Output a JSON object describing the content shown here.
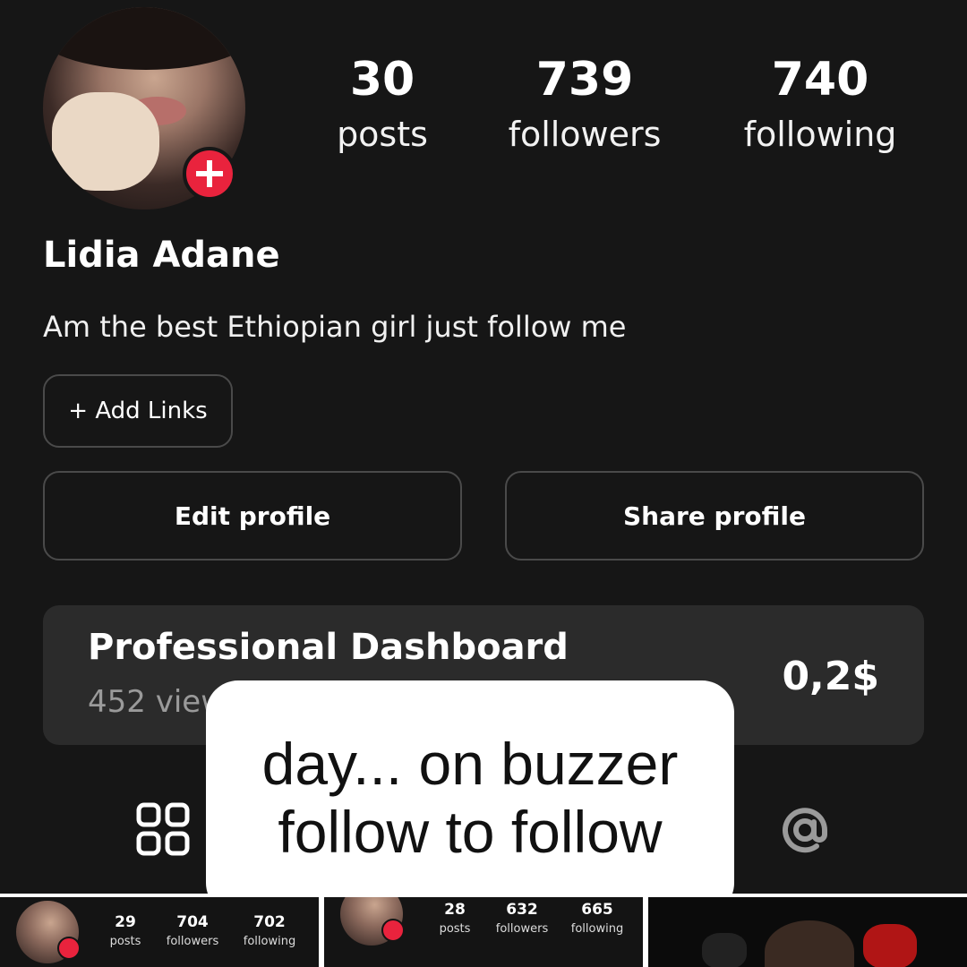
{
  "profile": {
    "name": "Lidia Adane",
    "bio": "Am the best Ethiopian girl just follow me",
    "stats": {
      "posts": {
        "value": "30",
        "label": "posts"
      },
      "followers": {
        "value": "739",
        "label": "followers"
      },
      "following": {
        "value": "740",
        "label": "following"
      }
    }
  },
  "buttons": {
    "add_links": "+ Add Links",
    "edit_profile": "Edit profile",
    "share_profile": "Share profile"
  },
  "dashboard": {
    "title": "Professional Dashboard",
    "views": "452 views",
    "earnings": "0,2$"
  },
  "caption": {
    "line1": "day... on buzzer",
    "line2": "follow to follow"
  },
  "thumbnails": [
    {
      "posts": "29",
      "followers": "704",
      "following": "702",
      "posts_label": "posts",
      "followers_label": "followers",
      "following_label": "following"
    },
    {
      "posts": "28",
      "followers": "632",
      "following": "665",
      "posts_label": "posts",
      "followers_label": "followers",
      "following_label": "following"
    }
  ],
  "icons": {
    "add": "plus-icon",
    "grid": "grid-icon",
    "mentions": "at-icon"
  },
  "colors": {
    "background": "#161616",
    "accent": "#e9233d",
    "card": "#2b2b2b"
  }
}
